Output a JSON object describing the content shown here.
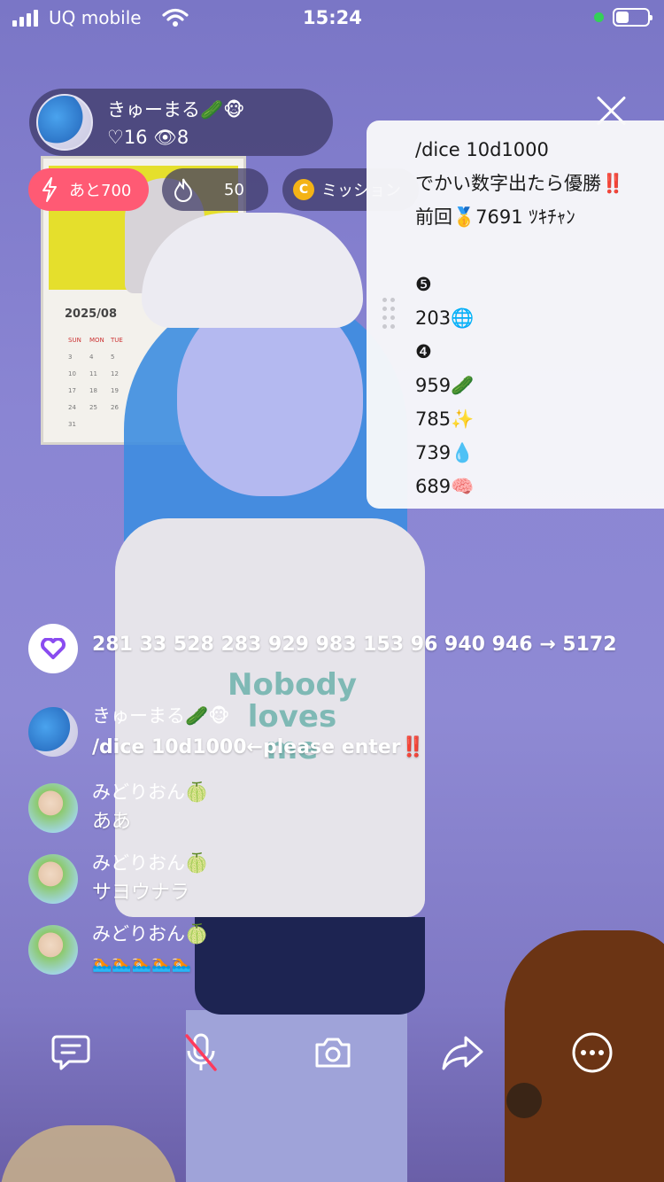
{
  "status_bar": {
    "carrier": "UQ mobile",
    "time": "15:24",
    "battery_level": 0.4
  },
  "background": {
    "calendar_month": "2025/08",
    "calendar_days": [
      "SUN",
      "MON",
      "TUE"
    ],
    "calendar_rows": [
      [
        "3",
        "4",
        "5"
      ],
      [
        "10",
        "11",
        "12"
      ],
      [
        "17",
        "18",
        "19"
      ],
      [
        "24",
        "25",
        "26"
      ],
      [
        "31"
      ]
    ],
    "shirt_print": [
      "Nobody",
      "loves",
      "me"
    ]
  },
  "host": {
    "name": "きゅーまる🥒🐵",
    "likes": "♡16",
    "viewers": "👁8"
  },
  "pills": {
    "remaining": "あと700",
    "fire_count": "50",
    "mission": "ミッション",
    "coin_letter": "C"
  },
  "note": {
    "lines": [
      "/dice 10d1000",
      "でかい数字出たら優勝‼️",
      "前回🥇7691 ﾂｷﾁｬﾝ",
      "",
      "❺",
      "203🌐",
      "❹",
      "959🥒",
      "785✨",
      "739💧",
      "689🧠"
    ]
  },
  "chat": {
    "messages": [
      {
        "avatar": "heart",
        "name": "",
        "text": "281 33 528 283 929 983 153 96 940 946 → 5172"
      },
      {
        "avatar": "blue",
        "name": "きゅーまる🥒🐵",
        "text": "/dice 10d1000←please enter‼️"
      },
      {
        "avatar": "green",
        "name": "みどりおん🍈",
        "text": "ああ"
      },
      {
        "avatar": "green",
        "name": "みどりおん🍈",
        "text": "サヨウナラ"
      },
      {
        "avatar": "green",
        "name": "みどりおん🍈",
        "text": "🏊🏻🏊🏻🏊🏻🏊🏻🏊🏻"
      }
    ]
  },
  "toolbar": {
    "icons": [
      "comment-icon",
      "mic-off-icon",
      "camera-icon",
      "share-icon",
      "more-icon"
    ]
  }
}
